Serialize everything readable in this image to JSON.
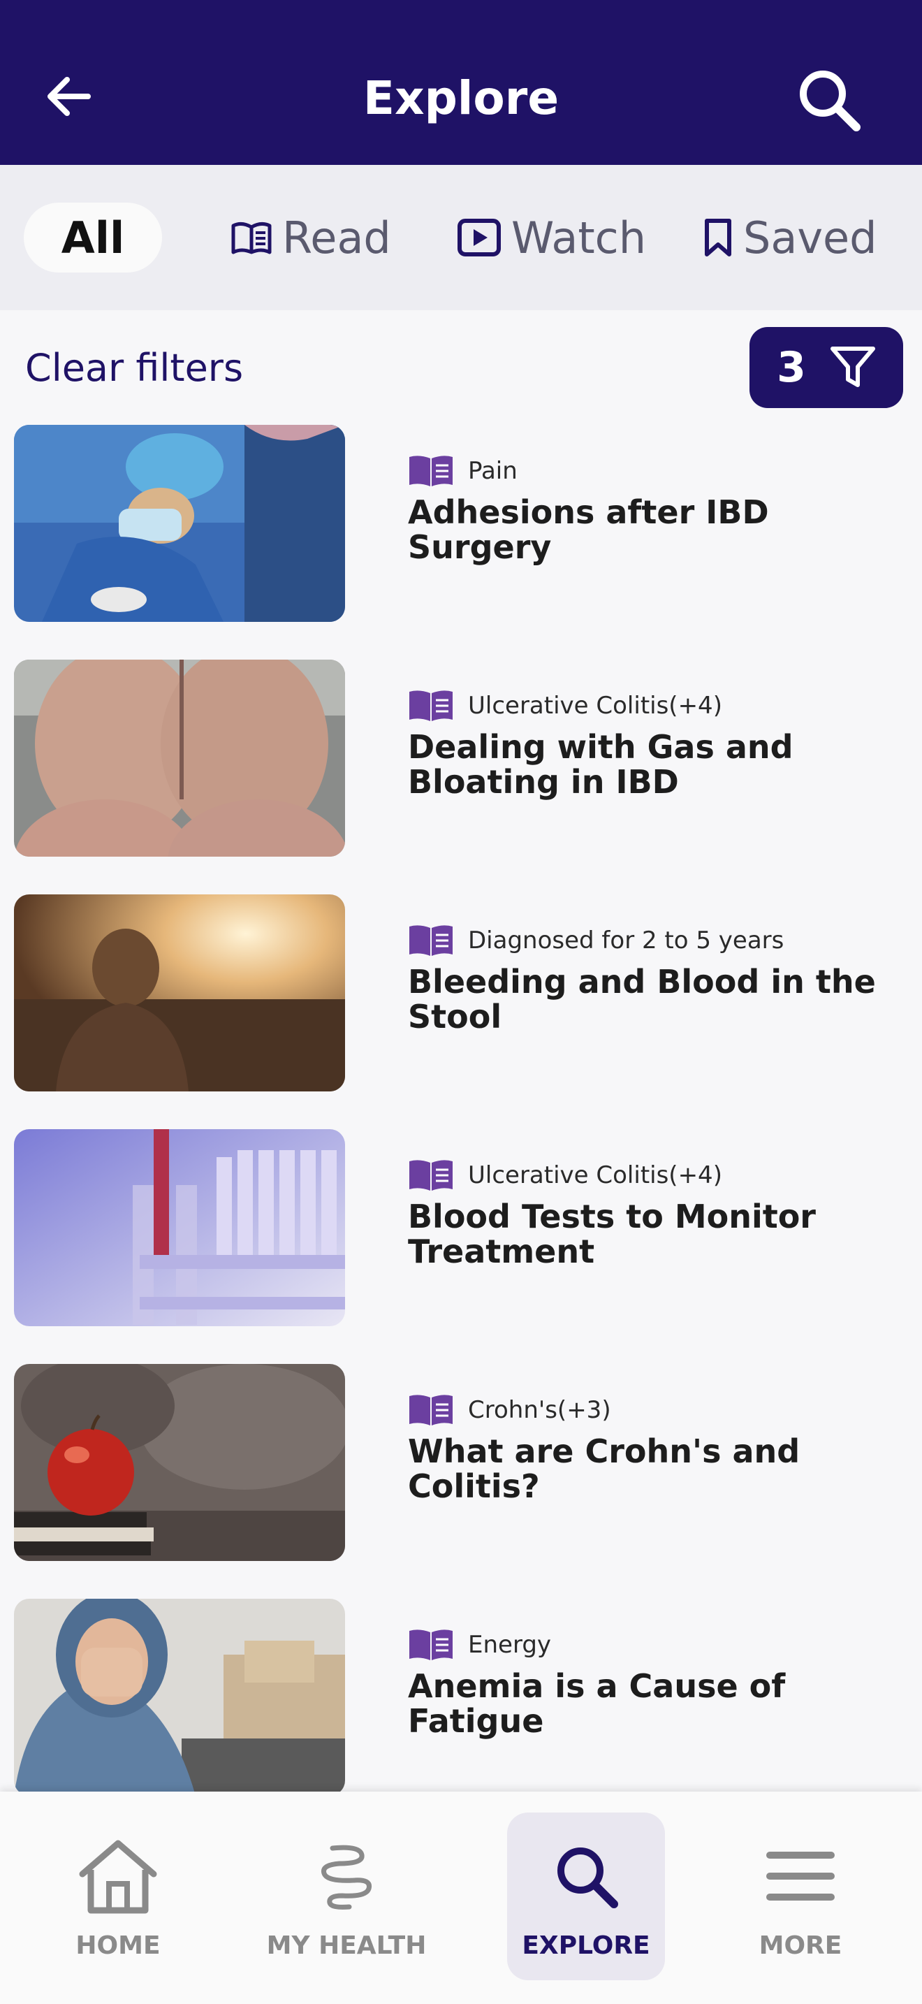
{
  "header": {
    "title": "Explore",
    "back_icon": "arrow-left-icon",
    "search_icon": "search-icon"
  },
  "tabs": [
    {
      "label": "All",
      "icon": "",
      "selected": true
    },
    {
      "label": "Read",
      "icon": "book-icon",
      "selected": false
    },
    {
      "label": "Watch",
      "icon": "play-icon",
      "selected": false
    },
    {
      "label": "Saved",
      "icon": "bookmark-icon",
      "selected": false
    }
  ],
  "filters": {
    "clear_label": "Clear filters",
    "count": "3",
    "icon": "funnel-icon"
  },
  "articles": [
    {
      "tag": "Pain",
      "title": "Adhesions after IBD Surgery",
      "type_icon": "book-icon"
    },
    {
      "tag": "Ulcerative Colitis(+4)",
      "title": "Dealing with Gas and Bloating in IBD",
      "type_icon": "book-icon"
    },
    {
      "tag": "Diagnosed for 2 to 5 years",
      "title": "Bleeding and Blood in the Stool",
      "type_icon": "book-icon"
    },
    {
      "tag": "Ulcerative Colitis(+4)",
      "title": "Blood Tests to Monitor Treatment",
      "type_icon": "book-icon"
    },
    {
      "tag": "Crohn's(+3)",
      "title": "What are Crohn's and Colitis?",
      "type_icon": "book-icon"
    },
    {
      "tag": "Energy",
      "title": "Anemia is a Cause of Fatigue",
      "type_icon": "book-icon"
    }
  ],
  "nav": [
    {
      "label": "HOME",
      "icon": "home-icon",
      "selected": false
    },
    {
      "label": "MY HEALTH",
      "icon": "intestine-icon",
      "selected": false
    },
    {
      "label": "EXPLORE",
      "icon": "search-icon",
      "selected": true
    },
    {
      "label": "MORE",
      "icon": "menu-icon",
      "selected": false
    }
  ],
  "colors": {
    "brand": "#1f1266",
    "accent": "#6b3fa0",
    "background": "#f7f7f9"
  }
}
